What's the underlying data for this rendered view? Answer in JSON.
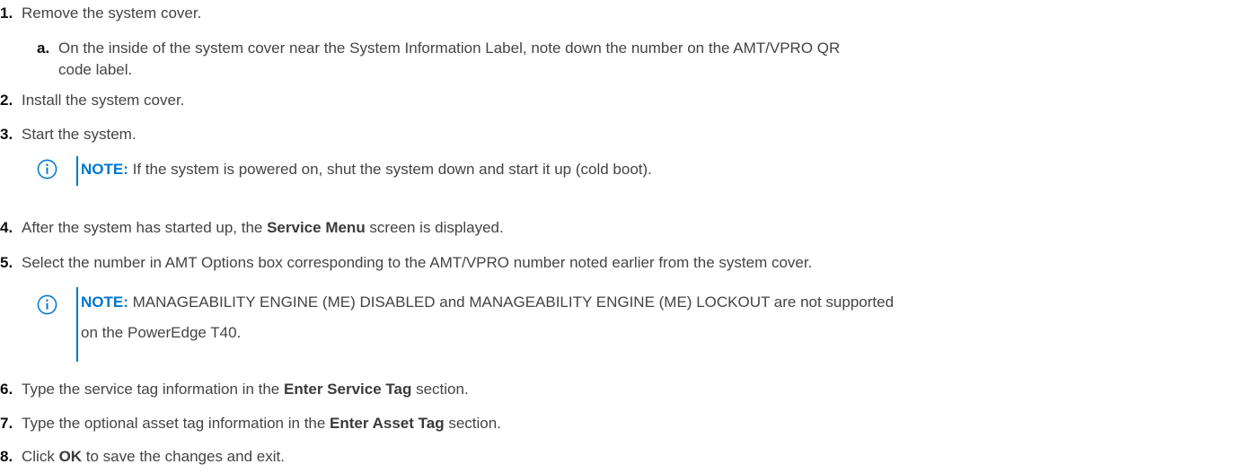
{
  "steps": [
    {
      "num": "1.",
      "text": "Remove the system cover."
    },
    {
      "num": "2.",
      "text": "Install the system cover."
    },
    {
      "num": "3.",
      "text": "Start the system."
    },
    {
      "num": "4.",
      "pre": "After the system has started up, the ",
      "bold": "Service Menu",
      "post": " screen is displayed."
    },
    {
      "num": "5.",
      "text": "Select the number in AMT Options box corresponding to the AMT/VPRO number noted earlier from the system cover."
    },
    {
      "num": "6.",
      "pre": "Type the service tag information in the ",
      "bold": "Enter Service Tag",
      "post": " section."
    },
    {
      "num": "7.",
      "pre": "Type the optional asset tag information in the ",
      "bold": "Enter Asset Tag",
      "post": " section."
    },
    {
      "num": "8.",
      "pre": "Click ",
      "bold": "OK",
      "post": " to save the changes and exit."
    }
  ],
  "substep_a": {
    "num": "a.",
    "line1": "On the inside of the system cover near the System Information Label, note down the number on the AMT/VPRO QR",
    "line2": "code label."
  },
  "notes": [
    {
      "label": "NOTE:",
      "line1": " If the system is powered on, shut the system down and start it up (cold boot).",
      "icon": "info-icon"
    },
    {
      "label": "NOTE:",
      "line1": " MANAGEABILITY ENGINE (ME) DISABLED and MANAGEABILITY ENGINE (ME) LOCKOUT are not supported",
      "line2": "on the PowerEdge T40.",
      "icon": "info-icon"
    }
  ],
  "colors": {
    "accent": "#0076ce",
    "text": "#444444",
    "number": "#0b0b0b"
  }
}
